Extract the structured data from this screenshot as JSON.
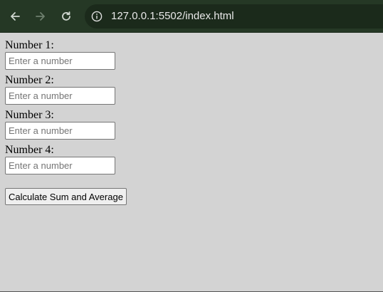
{
  "browser": {
    "url": "127.0.0.1:5502/index.html",
    "back_icon": "arrow-left-icon",
    "forward_icon": "arrow-right-icon",
    "reload_icon": "reload-icon",
    "info_icon": "info-icon"
  },
  "form": {
    "fields": [
      {
        "label": "Number 1:",
        "placeholder": "Enter a number",
        "value": ""
      },
      {
        "label": "Number 2:",
        "placeholder": "Enter a number",
        "value": ""
      },
      {
        "label": "Number 3:",
        "placeholder": "Enter a number",
        "value": ""
      },
      {
        "label": "Number 4:",
        "placeholder": "Enter a number",
        "value": ""
      }
    ],
    "button_label": "Calculate Sum and Average"
  },
  "colors": {
    "page_background": "#d3d3d3",
    "browser_bar": "#253825"
  }
}
